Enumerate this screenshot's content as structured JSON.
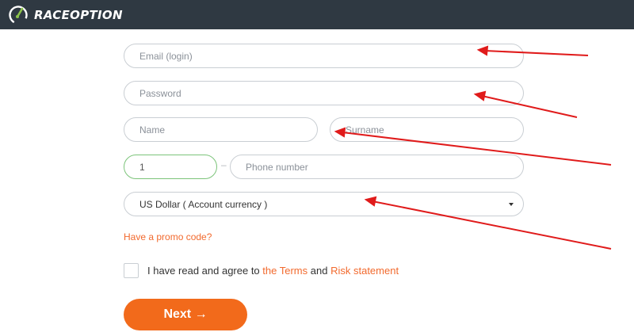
{
  "header": {
    "logo_part1": "RACE",
    "logo_part2": "OPTION",
    "logo_icon": "raceoption-logo-icon"
  },
  "form": {
    "email_placeholder": "Email (login)",
    "password_placeholder": "Password",
    "name_placeholder": "Name",
    "surname_placeholder": "Surname",
    "phone_code_value": "1",
    "phone_separator": "–",
    "phone_placeholder": "Phone number",
    "currency_selected": "US Dollar ( Account currency )",
    "promo_link": "Have a promo code?",
    "terms_text": "I have read and agree to",
    "terms_link": "the Terms",
    "terms_and": "and",
    "risk_link": "Risk statement",
    "next_label": "Next →"
  },
  "colors": {
    "header_bg": "#2f3942",
    "accent_orange": "#f26a1b",
    "link_orange": "#f26a2e",
    "active_border_green": "#7cc47a",
    "annotation_arrow_red": "#e01b1b"
  }
}
